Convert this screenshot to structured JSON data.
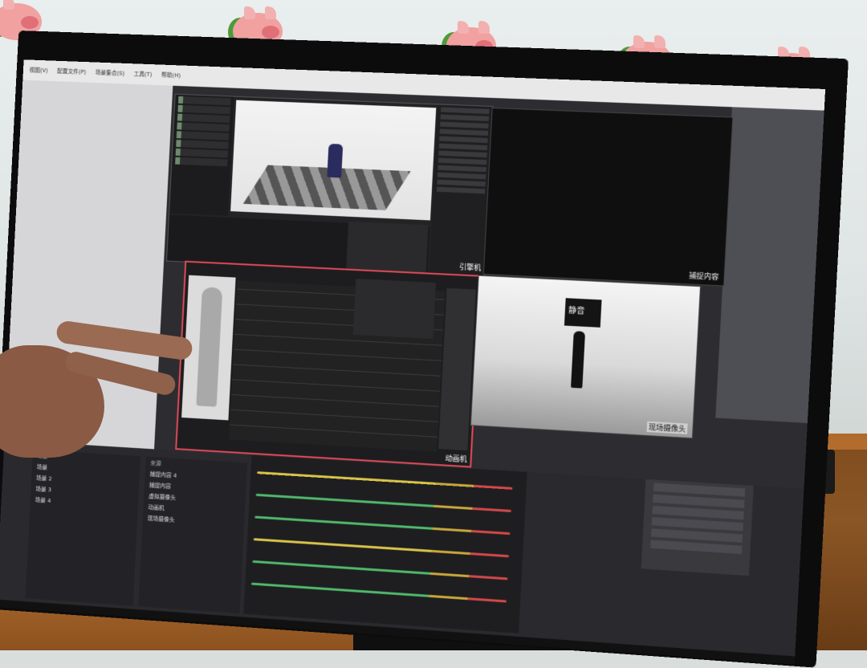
{
  "photo": {
    "screen_title": "",
    "capture_panel_label": "捕捉内容",
    "anim_panel_label": "动画机",
    "vcam_label": "引擎机",
    "camera_panel_label": "现场摄像头",
    "banner_text": "静音",
    "menu_items": [
      "视图(V)",
      "配置文件(P)",
      "场景集合(S)",
      "工具(T)",
      "帮助(H)"
    ],
    "scenes_header": "场景",
    "sources_header": "来源",
    "scene_items": [
      "场景",
      "场景 2",
      "场景 3",
      "场景 4"
    ],
    "source_items": [
      "捕捉内容 4",
      "捕捉内容",
      "虚拟摄像头",
      "动画机",
      "现场摄像头"
    ],
    "mixer_tracks": [
      {
        "color": "#d9c34a"
      },
      {
        "color": "#4fb86a"
      },
      {
        "color": "#4fb86a"
      },
      {
        "color": "#d9c34a"
      },
      {
        "color": "#4fb86a"
      },
      {
        "color": "#4fb86a"
      }
    ]
  }
}
